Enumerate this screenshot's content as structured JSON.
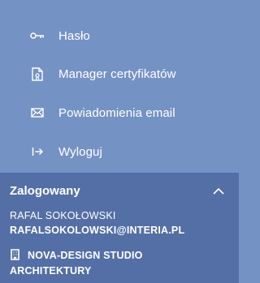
{
  "menu": {
    "items": [
      {
        "icon": "key-icon",
        "label": "Hasło"
      },
      {
        "icon": "document-certificate-icon",
        "label": "Manager certyfikatów"
      },
      {
        "icon": "envelope-icon",
        "label": "Powiadomienia email"
      },
      {
        "icon": "logout-icon",
        "label": "Wyloguj"
      }
    ]
  },
  "user_panel": {
    "title": "Zalogowany",
    "collapse_icon": "chevron-up-icon",
    "name": "RAFAL SOKOŁOWSKI",
    "email": "RAFALSOKOLOWSKI@INTERIA.PL",
    "company_icon": "building-icon",
    "company": "NOVA-DESIGN STUDIO ARCHITEKTURY"
  },
  "colors": {
    "menu_background": "#7592c5",
    "panel_background": "#546fa5",
    "text": "#ffffff"
  }
}
